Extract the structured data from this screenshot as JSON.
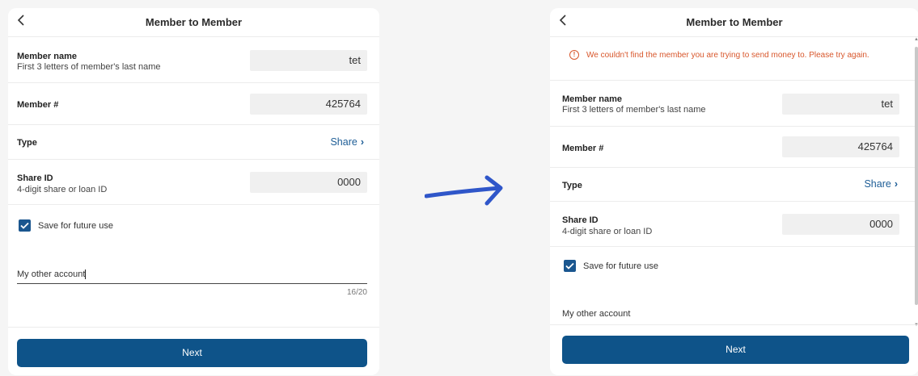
{
  "screen_before": {
    "title": "Member to Member",
    "member_name_label": "Member name",
    "member_name_hint": "First 3 letters of member's last name",
    "member_name_value": "tet",
    "member_number_label": "Member #",
    "member_number_value": "425764",
    "type_label": "Type",
    "type_value": "Share",
    "share_id_label": "Share ID",
    "share_id_hint": "4-digit share or loan ID",
    "share_id_value": "0000",
    "save_label": "Save for future use",
    "nickname_value": "My other account",
    "nickname_counter": "16/20",
    "next_label": "Next"
  },
  "screen_after": {
    "title": "Member to Member",
    "error_message": "We couldn't find the member you are trying to send money to. Please try again.",
    "member_name_label": "Member name",
    "member_name_hint": "First 3 letters of member's last name",
    "member_name_value": "tet",
    "member_number_label": "Member #",
    "member_number_value": "425764",
    "type_label": "Type",
    "type_value": "Share",
    "share_id_label": "Share ID",
    "share_id_hint": "4-digit share or loan ID",
    "share_id_value": "0000",
    "save_label": "Save for future use",
    "nickname_value": "My other account",
    "next_label": "Next"
  },
  "colors": {
    "primary": "#0e5389",
    "link": "#1d5d96",
    "error": "#d8572c",
    "arrow": "#2f56c9"
  },
  "icons": {
    "back": "chevron-left-icon",
    "type_chevron": "chevron-right-icon",
    "error": "alert-circle-icon",
    "checkbox": "checkmark-icon",
    "transition": "arrow-right-icon"
  }
}
